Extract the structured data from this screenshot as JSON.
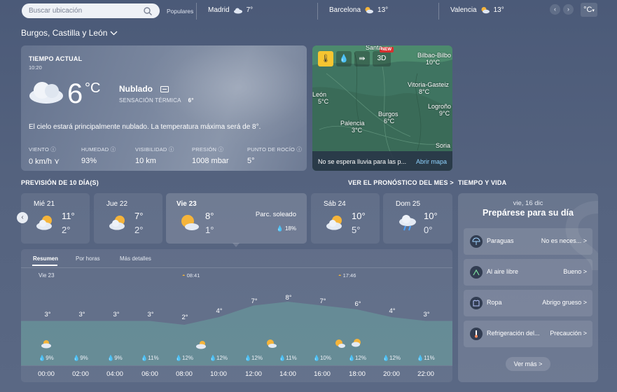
{
  "topbar": {
    "search_placeholder": "Buscar ubicación",
    "popular_label": "Populares",
    "cities": [
      {
        "name": "Madrid",
        "temp": "7°"
      },
      {
        "name": "Barcelona",
        "temp": "13°"
      },
      {
        "name": "Valencia",
        "temp": "13°"
      }
    ],
    "unit": "°C"
  },
  "location": "Burgos, Castilla y León",
  "current": {
    "title": "TIEMPO ACTUAL",
    "time": "10:20",
    "temp": "6",
    "unit": "°C",
    "condition": "Nublado",
    "feels_label": "SENSACIÓN TÉRMICA",
    "feels_value": "6°",
    "description": "El cielo estará principalmente nublado. La temperatura máxima será de 8°.",
    "metrics": [
      {
        "label": "VIENTO",
        "value": "0 km/h"
      },
      {
        "label": "HUMEDAD",
        "value": "93%"
      },
      {
        "label": "VISIBILIDAD",
        "value": "10 km"
      },
      {
        "label": "PRESIÓN",
        "value": "1008 mbar"
      },
      {
        "label": "PUNTO DE ROCÍO",
        "value": "5°"
      }
    ]
  },
  "map": {
    "badge": "NEW",
    "mode_3d": "3D",
    "labels": [
      {
        "name": "Santa",
        "temp": ""
      },
      {
        "name": "Bilbao-Bilbo",
        "temp": "10°C"
      },
      {
        "name": "Vitoria-Gasteiz",
        "temp": "8°C"
      },
      {
        "name": "León",
        "temp": "5°C"
      },
      {
        "name": "Logroño",
        "temp": "9°C"
      },
      {
        "name": "Burgos",
        "temp": "6°C"
      },
      {
        "name": "Palencia",
        "temp": "3°C"
      },
      {
        "name": "Soria",
        "temp": ""
      }
    ],
    "footer_text": "No se espera lluvia para las p...",
    "footer_link": "Abrir mapa"
  },
  "forecast": {
    "title": "PREVISIÓN DE 10 DÍA(S)",
    "month_link": "VER EL PRONÓSTICO DEL MES >",
    "days": [
      {
        "name": "Mié 21",
        "hi": "11°",
        "lo": "2°"
      },
      {
        "name": "Jue 22",
        "hi": "7°",
        "lo": "2°"
      },
      {
        "name": "Vie 23",
        "hi": "8°",
        "lo": "1°",
        "cond": "Parc. soleado",
        "rain": "18%"
      },
      {
        "name": "Sáb 24",
        "hi": "10°",
        "lo": "5°"
      },
      {
        "name": "Dom 25",
        "hi": "10°",
        "lo": "0°"
      }
    ]
  },
  "hourly": {
    "tabs": [
      "Resumen",
      "Por horas",
      "Más detalles"
    ],
    "day_label": "Vie 23",
    "sunrise": "08:41",
    "sunset": "17:46",
    "hours": [
      "00:00",
      "02:00",
      "04:00",
      "06:00",
      "08:00",
      "10:00",
      "12:00",
      "14:00",
      "16:00",
      "18:00",
      "20:00",
      "22:00"
    ],
    "temps": [
      "3°",
      "3°",
      "3°",
      "3°",
      "2°",
      "4°",
      "7°",
      "8°",
      "7°",
      "6°",
      "4°",
      "3°"
    ],
    "rain": [
      "9%",
      "9%",
      "9%",
      "11%",
      "12%",
      "12%",
      "12%",
      "11%",
      "10%",
      "12%",
      "12%",
      "11%"
    ]
  },
  "life": {
    "section_title": "TIEMPO Y VIDA",
    "date": "vie, 16 dic",
    "heading": "Prepárese para su día",
    "rows": [
      {
        "name": "Paraguas",
        "value": "No es neces... >"
      },
      {
        "name": "Al aire libre",
        "value": "Bueno >"
      },
      {
        "name": "Ropa",
        "value": "Abrigo grueso >"
      },
      {
        "name": "Refrigeración del...",
        "value": "Precaución >"
      }
    ],
    "more": "Ver más >"
  },
  "colors": {
    "accent": "#f6c531",
    "link": "#8fd3ff",
    "chart_fill": "#6aa3a0"
  }
}
